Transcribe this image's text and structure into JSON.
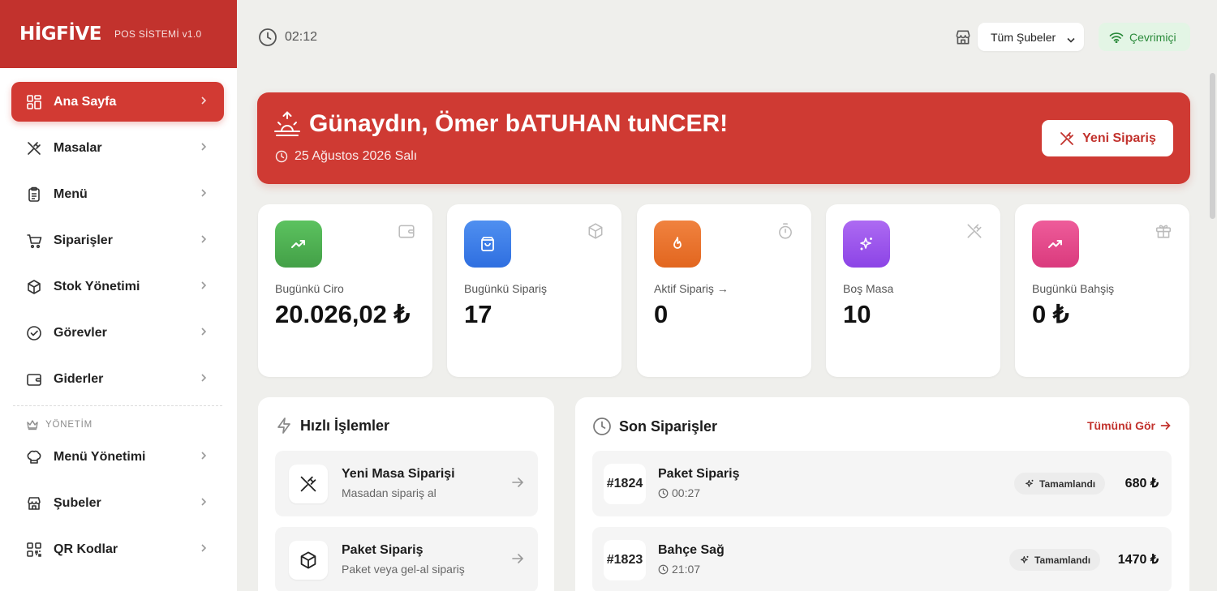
{
  "brand": {
    "logo": "HİGFİVE",
    "version": "POS SİSTEMİ v1.0"
  },
  "sidebar": {
    "items": [
      {
        "label": "Ana Sayfa",
        "icon": "grid-icon",
        "active": true
      },
      {
        "label": "Masalar",
        "icon": "utensils-crossed-icon"
      },
      {
        "label": "Menü",
        "icon": "clipboard-icon"
      },
      {
        "label": "Siparişler",
        "icon": "cart-icon"
      },
      {
        "label": "Stok Yönetimi",
        "icon": "box-icon"
      },
      {
        "label": "Görevler",
        "icon": "check-circle-icon"
      },
      {
        "label": "Giderler",
        "icon": "wallet-icon"
      }
    ],
    "section_label": "YÖNETİM",
    "admin_items": [
      {
        "label": "Menü Yönetimi",
        "icon": "chef-hat-icon"
      },
      {
        "label": "Şubeler",
        "icon": "store-icon"
      },
      {
        "label": "QR Kodlar",
        "icon": "qr-code-icon"
      }
    ]
  },
  "topbar": {
    "time": "02:12",
    "branch_select": "Tüm Şubeler",
    "status": "Çevrimiçi"
  },
  "hero": {
    "greeting": "Günaydın, Ömer bATUHAN tuNCER!",
    "date": "25 Ağustos 2026 Salı",
    "button": "Yeni Sipariş",
    "color": "#cf3a33"
  },
  "stats": [
    {
      "label": "Bugünkü Ciro",
      "value": "20.026,02 ₺",
      "color": "#4caf50"
    },
    {
      "label": "Bugünkü Sipariş",
      "value": "17",
      "color": "#3b7bea"
    },
    {
      "label": "Aktif Sipariş →",
      "value": "0",
      "color": "#ea7230"
    },
    {
      "label": "Boş Masa",
      "value": "10",
      "color": "#9a4fe8"
    },
    {
      "label": "Bugünkü Bahşiş",
      "value": "0 ₺",
      "color": "#e44c8c"
    }
  ],
  "quick_actions": {
    "title": "Hızlı İşlemler",
    "items": [
      {
        "title": "Yeni Masa Siparişi",
        "subtitle": "Masadan sipariş al"
      },
      {
        "title": "Paket Sipariş",
        "subtitle": "Paket veya gel-al sipariş"
      }
    ]
  },
  "recent_orders": {
    "title": "Son Siparişler",
    "see_all": "Tümünü Gör",
    "items": [
      {
        "id": "#1824",
        "name": "Paket Sipariş",
        "time": "00:27",
        "status": "Tamamlandı",
        "amount": "680 ₺"
      },
      {
        "id": "#1823",
        "name": "Bahçe Sağ",
        "time": "21:07",
        "status": "Tamamlandı",
        "amount": "1470 ₺"
      }
    ]
  }
}
